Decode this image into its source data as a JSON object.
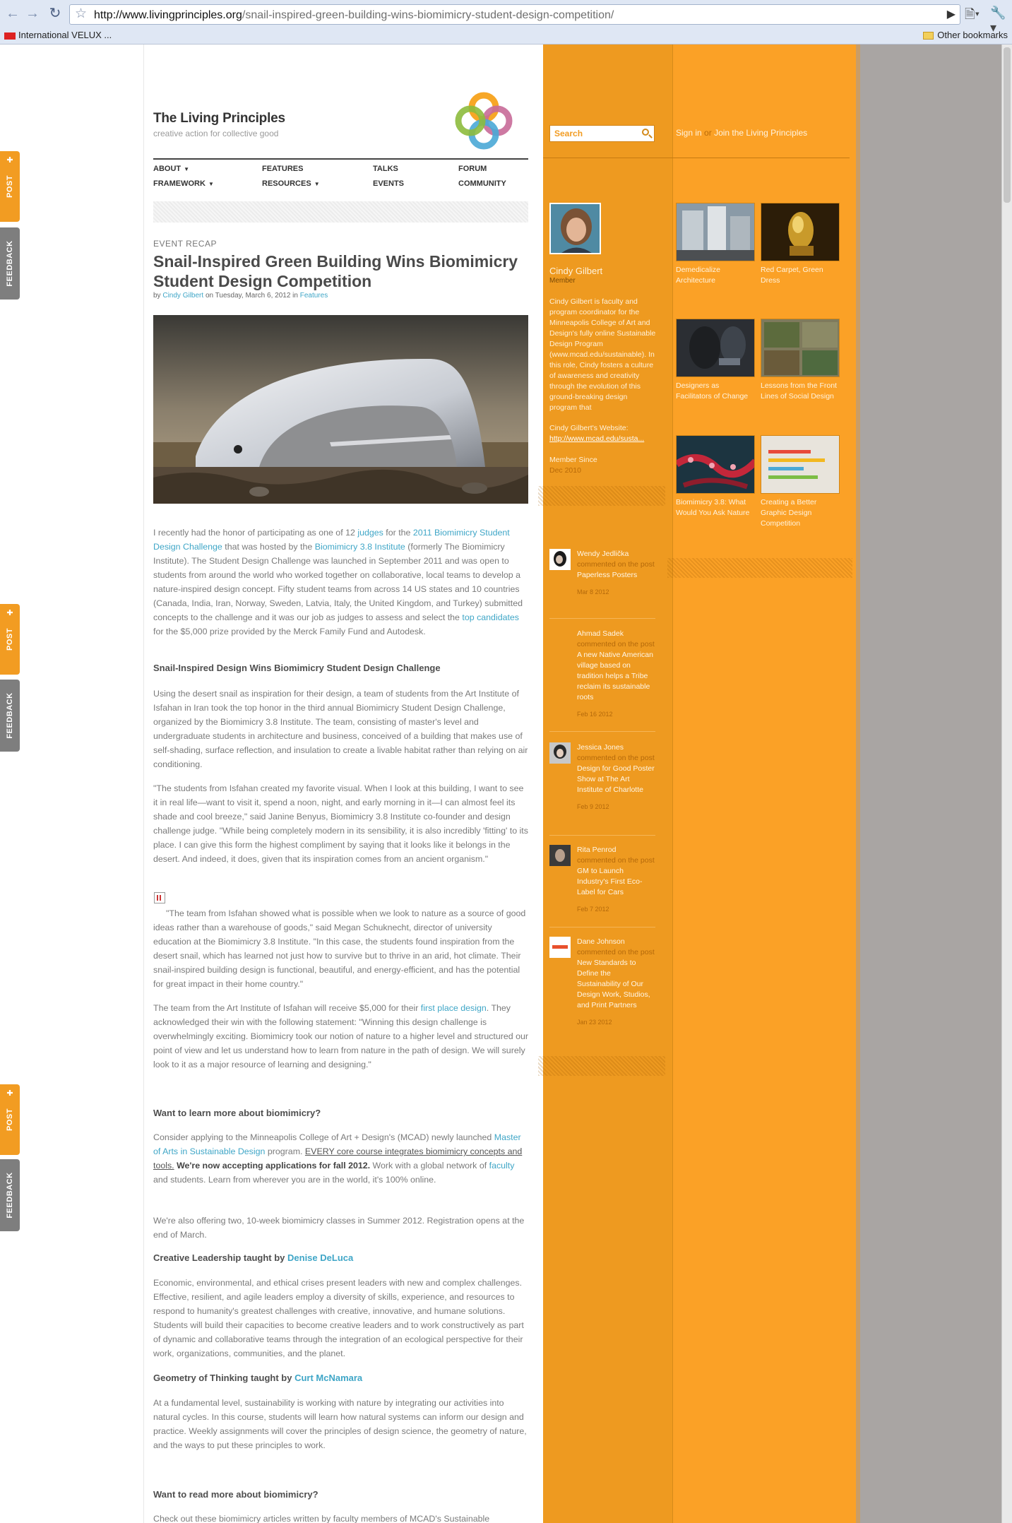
{
  "browser": {
    "url_host": "http://www.livingprinciples.org",
    "url_path": "/snail-inspired-green-building-wins-biomimicry-student-design-competition/",
    "bookmark_1": "International VELUX ...",
    "bookmark_other": "Other bookmarks"
  },
  "side_tabs": {
    "post": "POST",
    "feedback": "FEEDBACK"
  },
  "site": {
    "title": "The Living Principles",
    "tagline": "creative action for collective good",
    "nav": {
      "about": "ABOUT",
      "framework": "FRAMEWORK",
      "features": "FEATURES",
      "resources": "RESOURCES",
      "talks": "TALKS",
      "events": "EVENTS",
      "forum": "FORUM",
      "community": "COMMUNITY"
    }
  },
  "search": {
    "placeholder": "Search"
  },
  "account": {
    "signin": "Sign in",
    "or": "or",
    "join": "Join the Living Principles"
  },
  "post": {
    "category": "EVENT RECAP",
    "title": "Snail-Inspired Green Building Wins Biomimicry Student Design Competition",
    "meta_by": "by",
    "author": "Cindy Gilbert",
    "meta_on": "on Tuesday, March 6, 2012 in",
    "section": "Features",
    "p1_a": "I recently had the honor of participating as one of 12",
    "p1_link1": "judges",
    "p1_b": "for the",
    "p1_link2": "2011 Biomimicry Student Design Challenge",
    "p1_c": "that was hosted by the",
    "p1_link3": "Biomimicry 3.8 Institute",
    "p1_d": "(formerly The Biomimicry Institute). The Student Design Challenge was launched in September 2011 and was open to students from around the world who worked together on collaborative, local teams to develop a nature-inspired design concept. Fifty student teams from across 14 US states and 10 countries (Canada, India, Iran, Norway, Sweden, Latvia, Italy, the United Kingdom, and Turkey) submitted concepts to the challenge and it was our job as judges to assess and select the",
    "p1_link4": "top candidates",
    "p1_e": "for the $5,000 prize provided by the Merck Family Fund and Autodesk.",
    "h1": "Snail-Inspired Design Wins Biomimicry Student Design Challenge",
    "p2": "Using the desert snail as inspiration for their design, a team of students from the Art Institute of Isfahan in Iran took the top honor in the third annual Biomimicry Student Design Challenge, organized by the Biomimicry 3.8 Institute. The team, consisting of master's level and undergraduate students in architecture and business, conceived of a building that makes use of self-shading, surface reflection, and insulation to create a livable habitat rather than relying on air conditioning.",
    "p3": "\"The students from Isfahan created my favorite visual. When I look at this building, I want to see it in real life—want to visit it, spend a noon, night, and early morning in it—I can almost feel its shade and cool breeze,\" said Janine Benyus, Biomimicry 3.8 Institute co-founder and design challenge judge. \"While being completely modern in its sensibility, it is also incredibly 'fitting' to its place. I can give this form the highest compliment by saying that it looks like it belongs in the desert.  And indeed, it does, given that its inspiration comes from an ancient organism.\"",
    "p4": "\"The team from Isfahan showed what is possible when we look to nature as a source of good ideas rather than a warehouse of goods,\" said Megan Schuknecht, director of university education at the Biomimicry 3.8 Institute. \"In this case, the students found inspiration from the desert snail, which has learned not just how to survive but to thrive in an arid, hot climate. Their snail-inspired building design is functional, beautiful, and energy-efficient, and has the potential for great impact in their home country.\"",
    "p5_a": "The team from the Art Institute of Isfahan will receive $5,000 for their",
    "p5_link": "first place design",
    "p5_b": ". They acknowledged their win with the following statement: \"Winning this design challenge is overwhelmingly exciting. Biomimicry took our notion of nature to a higher level and structured our point of view and let us understand how to learn from nature in the path of design. We will surely look to it as a major resource of learning and designing.\"",
    "h2": "Want to learn more about biomimicry?",
    "p6_a": "Consider applying to the Minneapolis College of Art + Design's (MCAD) newly launched",
    "p6_link1": "Master of Arts in Sustainable Design",
    "p6_b": "program.",
    "p6_underline": "EVERY core course integrates biomimicry concepts and tools.",
    "p6_bold": "We're now accepting applications for fall 2012.",
    "p6_c": "Work with a global network of",
    "p6_link2": "faculty",
    "p6_d": "and students. Learn from wherever you are in the world, it's 100% online.",
    "p7": "We're also offering two, 10-week biomimicry classes in Summer 2012. Registration opens at the end of March.",
    "h3_a": "Creative Leadership taught by",
    "h3_link": "Denise DeLuca",
    "p8": "Economic, environmental, and ethical crises present leaders with new and complex challenges. Effective, resilient, and agile leaders employ a diversity of skills, experience, and resources to respond to humanity's greatest challenges with creative, innovative, and humane solutions. Students will build their capacities to become creative leaders and to work constructively as part of dynamic and collaborative teams through the integration of an ecological perspective for their work, organizations, communities, and the planet.",
    "h4_a": "Geometry of Thinking taught by",
    "h4_link": "Curt McNamara",
    "p9": "At a fundamental level, sustainability is working with nature by integrating our activities into natural cycles. In this course, students will learn how natural systems can inform our design and practice. Weekly assignments will cover the principles of design science, the geometry of nature, and the ways to put these principles to work.",
    "h5": "Want to read more about biomimicry?",
    "p10": "Check out these biomimicry articles written by faculty members of MCAD's Sustainable"
  },
  "profile": {
    "name": "Cindy Gilbert",
    "role": "Member",
    "bio": "Cindy Gilbert is faculty and program coordinator for the Minneapolis College of Art and Design's fully online Sustainable Design Program (www.mcad.edu/sustainable). In this role, Cindy fosters a culture of awareness and creativity through the evolution of this ground-breaking design program that",
    "website_label": "Cindy Gilbert's Website:",
    "website_url": "http://www.mcad.edu/susta...",
    "member_since_label": "Member Since",
    "member_since_value": "Dec 2010"
  },
  "features": [
    {
      "title": "Demedicalize Architecture"
    },
    {
      "title": "Red Carpet, Green Dress"
    },
    {
      "title": "Designers as Facilitators of Change"
    },
    {
      "title": "Lessons from the Front Lines of Social Design"
    },
    {
      "title": "Biomimicry 3.8: What Would You Ask Nature"
    },
    {
      "title": "Creating a Better Graphic Design Competition"
    }
  ],
  "comments": [
    {
      "author": "Wendy Jedlička",
      "action": "commented on the post",
      "post": "Paperless Posters",
      "date": "Mar 8 2012"
    },
    {
      "author": "Ahmad Sadek",
      "action": "commented on the post",
      "post": "A new Native American village based on tradition helps a Tribe reclaim its sustainable roots",
      "date": "Feb 16 2012"
    },
    {
      "author": "Jessica Jones",
      "action": "commented on the post",
      "post": "Design for Good Poster Show at The Art Institute of Charlotte",
      "date": "Feb 9 2012"
    },
    {
      "author": "Rita Penrod",
      "action": "commented on the post",
      "post": "GM to Launch Industry's First Eco-Label for Cars",
      "date": "Feb 7 2012"
    },
    {
      "author": "Dane Johnson",
      "action": "commented on the post",
      "post": "New Standards to Define the Sustainability of Our Design Work, Studios, and Print Partners",
      "date": "Jan 23 2012"
    }
  ],
  "colors": {
    "accent_orange": "#f29c22",
    "link_blue": "#3fa6c7",
    "sidebar_orange": "#fba126"
  },
  "icons": [
    "star-icon",
    "search-icon",
    "wrench-icon",
    "folder-icon",
    "back-icon",
    "forward-icon",
    "reload-icon"
  ]
}
